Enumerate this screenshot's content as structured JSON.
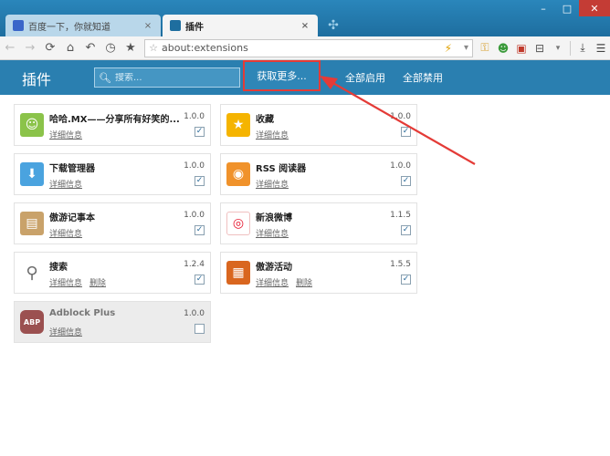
{
  "tabs": [
    {
      "title": "百度一下，你就知道",
      "active": false
    },
    {
      "title": "插件",
      "active": true
    }
  ],
  "window": {
    "minimize": "–",
    "maximize": "□",
    "close": "✕"
  },
  "toolbar": {
    "address": "about:extensions",
    "icons": [
      "back-arrow-icon",
      "forward-arrow-icon",
      "refresh-icon",
      "home-icon",
      "undo-icon",
      "history-icon",
      "bookmark-star-icon"
    ]
  },
  "header": {
    "title": "插件",
    "search_placeholder": "搜索...",
    "get_more": "获取更多...",
    "enable_all": "全部启用",
    "disable_all": "全部禁用"
  },
  "extensions": [
    {
      "name": "哈哈.MX——分享所有好笑的...",
      "version": "1.0.0",
      "detail": "详细信息",
      "checked": true,
      "icon": "smiley-icon",
      "color": "#8bc34a"
    },
    {
      "name": "收藏",
      "version": "1.0.0",
      "detail": "详细信息",
      "checked": true,
      "icon": "star-icon",
      "color": "#f5b400"
    },
    {
      "name": "下载管理器",
      "version": "1.0.0",
      "detail": "详细信息",
      "checked": true,
      "icon": "download-icon",
      "color": "#4aa3df"
    },
    {
      "name": "RSS 阅读器",
      "version": "1.0.0",
      "detail": "详细信息",
      "checked": true,
      "icon": "rss-icon",
      "color": "#f0922b"
    },
    {
      "name": "傲游记事本",
      "version": "1.0.0",
      "detail": "详细信息",
      "checked": true,
      "icon": "notepad-icon",
      "color": "#c9a26a"
    },
    {
      "name": "新浪微博",
      "version": "1.1.5",
      "detail": "详细信息",
      "checked": true,
      "icon": "weibo-icon",
      "color": "#e6162d"
    },
    {
      "name": "搜索",
      "version": "1.2.4",
      "detail": "详细信息",
      "delete": "删除",
      "checked": true,
      "icon": "magnifier-icon",
      "color": "#6d6d6d"
    },
    {
      "name": "傲游活动",
      "version": "1.5.5",
      "detail": "详细信息",
      "delete": "删除",
      "checked": true,
      "icon": "gift-icon",
      "color": "#d9661f"
    },
    {
      "name": "Adblock Plus",
      "version": "1.0.0",
      "detail": "详细信息",
      "checked": false,
      "disabled": true,
      "icon": "abp-stop-icon",
      "color": "#9b5050"
    }
  ],
  "colors": {
    "accent": "#2a7fb0",
    "highlight": "#e43b37"
  }
}
